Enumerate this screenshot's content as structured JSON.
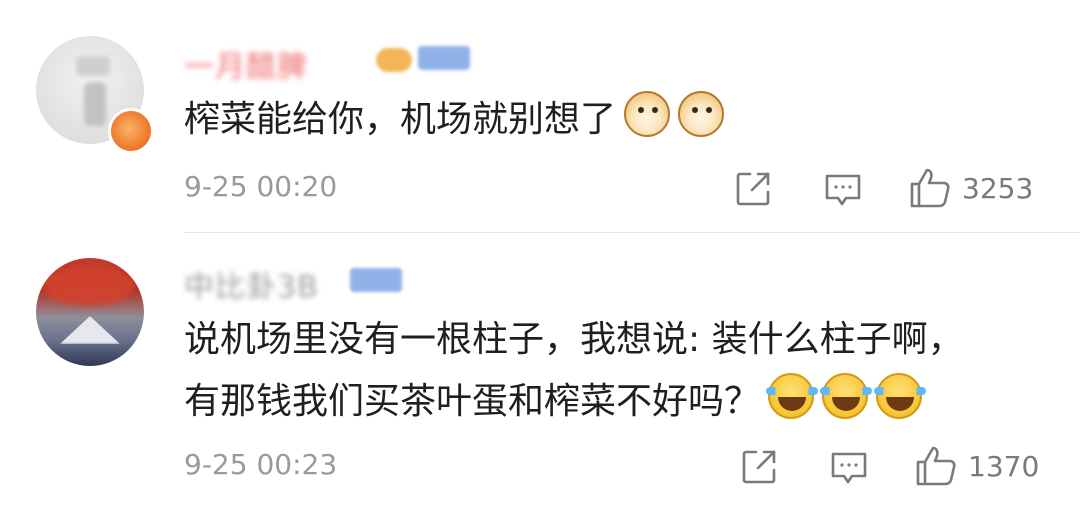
{
  "comments": [
    {
      "username": "一月醋脾",
      "text": "榨菜能给你，机场就别想了",
      "emojis": [
        "doge-emoji",
        "doge-emoji"
      ],
      "timestamp": "9-25 00:20",
      "likes": "3253"
    },
    {
      "username": "中比卦3B",
      "text_line1": "说机场里没有一根柱子，我想说: 装什么柱子啊，",
      "text_line2": "有那钱我们买茶叶蛋和榨菜不好吗？",
      "emojis": [
        "laugh-cry-emoji",
        "laugh-cry-emoji",
        "laugh-cry-emoji"
      ],
      "timestamp": "9-25 00:23",
      "likes": "1370"
    }
  ],
  "icons": {
    "repost": "repost-icon",
    "comment": "comment-icon",
    "like": "thumbs-up-icon"
  },
  "colors": {
    "username_vip": "#f07070",
    "username_normal": "#9a9a9a",
    "meta_text": "#9a9a9a",
    "icon_gray": "#7a7a7a",
    "divider": "#e5e5e5"
  }
}
